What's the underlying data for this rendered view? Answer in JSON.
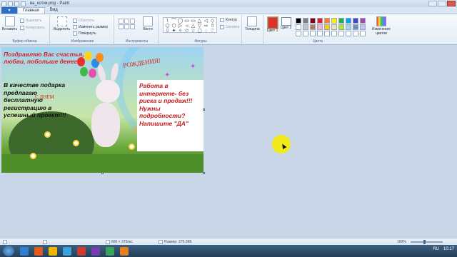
{
  "window": {
    "title": "ва_котик.png - Paint"
  },
  "tabs": {
    "home": "Главная",
    "view": "Вид"
  },
  "clipboard": {
    "paste": "Вставить",
    "cut": "Вырезать",
    "copy": "Копировать",
    "group": "Буфер обмена"
  },
  "image": {
    "select": "Выделить",
    "crop": "Обрезать",
    "resize": "Изменить размер",
    "rotate": "Повернуть",
    "group": "Изображение"
  },
  "tools": {
    "group": "Инструменты",
    "brushes": "Кисти"
  },
  "shapes": {
    "group": "Фигуры",
    "outline": "Контур",
    "fill": "Заливка",
    "glyphs": [
      "\\",
      "⌒",
      "◯",
      "▭",
      "▭",
      "△",
      "◁",
      "◇",
      "⬠",
      "⬡",
      "▷",
      "◃",
      "△",
      "▽",
      "⇨",
      "⇧",
      "⇩",
      "✦",
      "✧",
      "✩",
      "☆",
      "▢",
      "◌",
      "♡"
    ]
  },
  "thickness": {
    "label": "Толщина"
  },
  "colors": {
    "color1": "Цвет 1",
    "color2": "Цвет 2",
    "edit": "Изменение цветов",
    "group": "Цвета",
    "color1_value": "#e0302a",
    "color2_value": "#ffffff",
    "palette": [
      "#000000",
      "#7f7f7f",
      "#880015",
      "#ed1c24",
      "#ff7f27",
      "#fff200",
      "#22b14c",
      "#00a2e8",
      "#3f48cc",
      "#a349a4",
      "#ffffff",
      "#c3c3c3",
      "#b97a57",
      "#ffaec9",
      "#ffc90e",
      "#efe4b0",
      "#b5e61d",
      "#99d9ea",
      "#7092be",
      "#c8bfe7",
      "#ffffff",
      "#ffffff",
      "#ffffff",
      "#ffffff",
      "#ffffff",
      "#ffffff",
      "#ffffff",
      "#ffffff",
      "#ffffff",
      "#ffffff"
    ]
  },
  "canvas": {
    "red_text": "Поздравляю Вас счастья, любви, побольше денег!!!",
    "black_text": "В качестве подарка предлагаю бесплатную регистрацию в успешный проект!!!",
    "birthday": "РОЖДЕНИЯ!",
    "partial": "С ДНЕМ",
    "offer_text": "Работа в интернете- без риска и продаж!!! Нужны подробности? Напишите \"ДА\"",
    "balloons": [
      "#e8352a",
      "#ffd21f",
      "#2d8ce0",
      "#40b84a",
      "#e64fb0",
      "#ff8a1f"
    ]
  },
  "status": {
    "dimensions": "600 × 375пкс",
    "size": "Размер: 275,0КБ",
    "zoom": "100%",
    "zoom_level_percent": 100
  },
  "taskbar": {
    "lang": "RU",
    "time": "10:17",
    "apps": [
      "#2f7fd0",
      "#e05a1e",
      "#f1b600",
      "#36a3e0",
      "#d13b2e",
      "#7a3ab0",
      "#3aa25a",
      "#e67e22"
    ]
  }
}
